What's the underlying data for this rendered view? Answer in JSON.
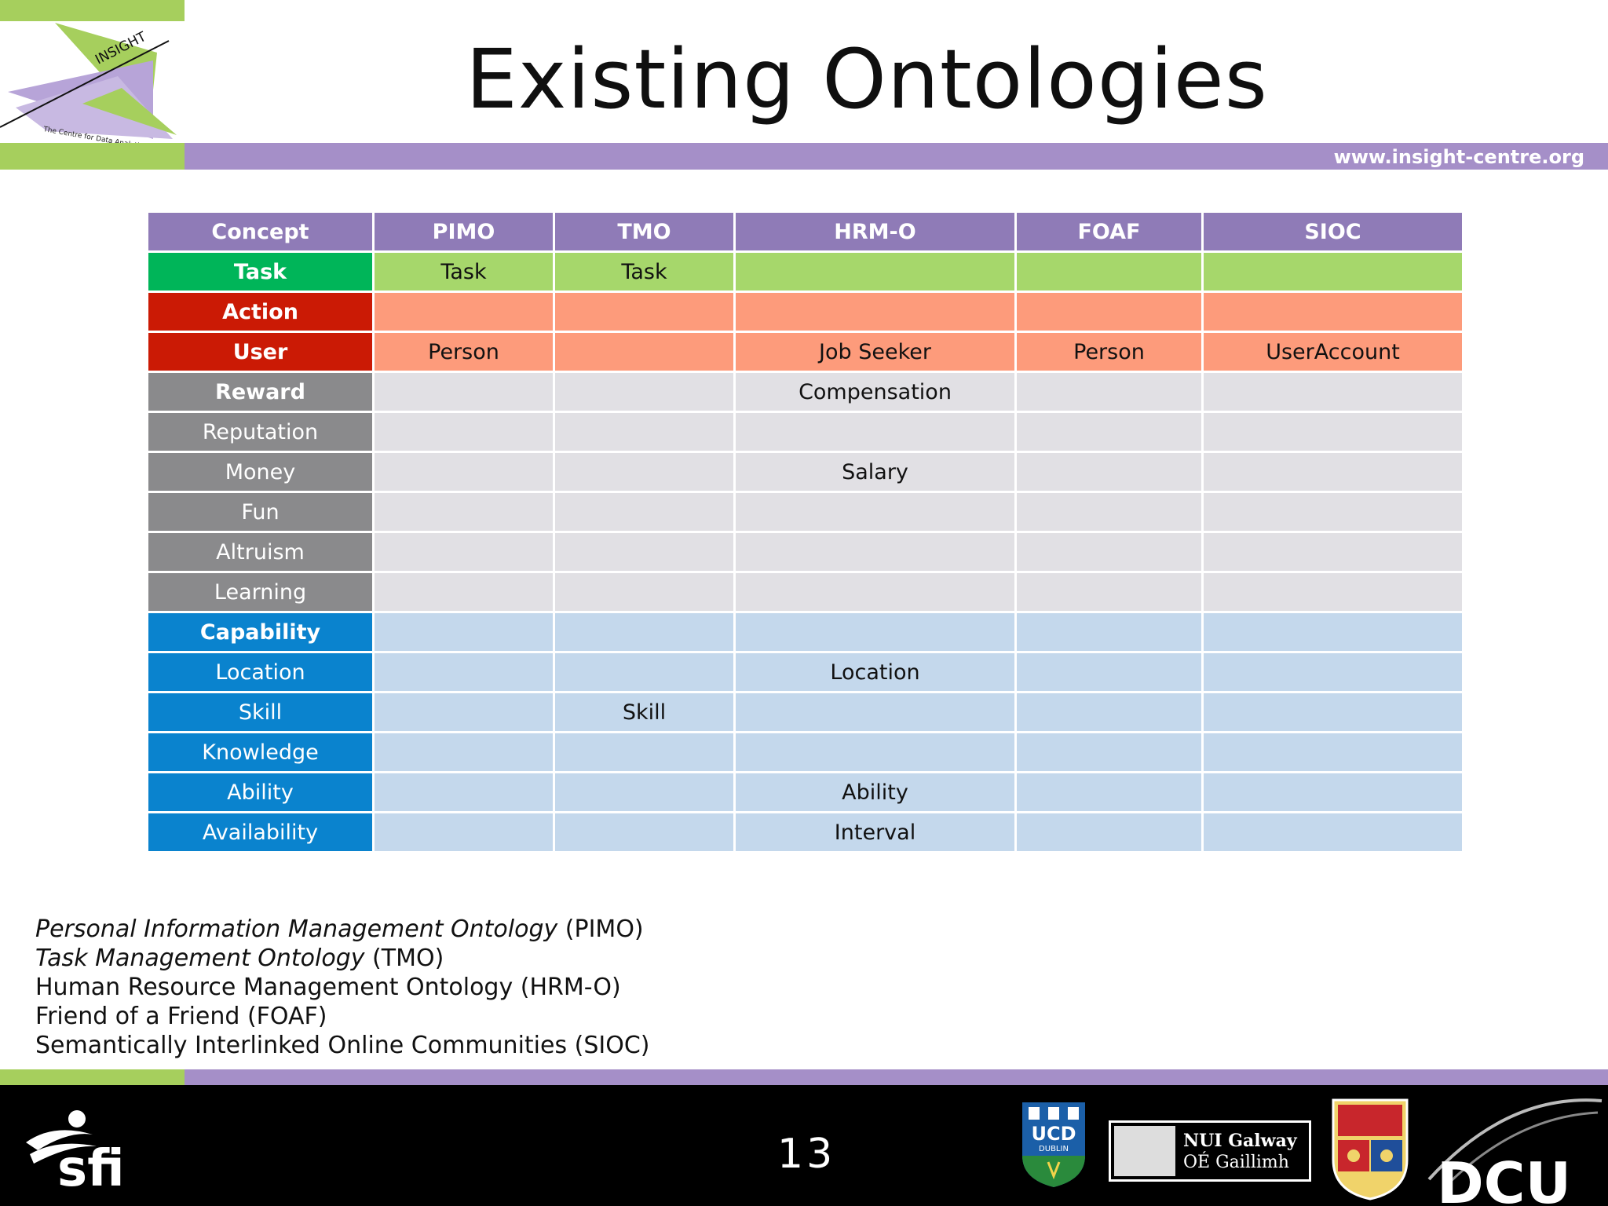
{
  "slide": {
    "title": "Existing Ontologies",
    "url": "www.insight-centre.org",
    "page_number": "13"
  },
  "logo": {
    "name": "INSIGHT",
    "tagline": "The Centre for Data Analytics"
  },
  "table": {
    "headers": [
      "Concept",
      "PIMO",
      "TMO",
      "HRM-O",
      "FOAF",
      "SIOC"
    ],
    "rows": [
      {
        "concept": "Task",
        "cells": [
          "Task",
          "Task",
          "",
          "",
          ""
        ]
      },
      {
        "concept": "Action",
        "cells": [
          "",
          "",
          "",
          "",
          ""
        ]
      },
      {
        "concept": "User",
        "cells": [
          "Person",
          "",
          "Job Seeker",
          "Person",
          "UserAccount"
        ]
      },
      {
        "concept": "Reward",
        "cells": [
          "",
          "",
          "Compensation",
          "",
          ""
        ]
      },
      {
        "concept": "Reputation",
        "cells": [
          "",
          "",
          "",
          "",
          ""
        ]
      },
      {
        "concept": "Money",
        "cells": [
          "",
          "",
          "Salary",
          "",
          ""
        ]
      },
      {
        "concept": "Fun",
        "cells": [
          "",
          "",
          "",
          "",
          ""
        ]
      },
      {
        "concept": "Altruism",
        "cells": [
          "",
          "",
          "",
          "",
          ""
        ]
      },
      {
        "concept": "Learning",
        "cells": [
          "",
          "",
          "",
          "",
          ""
        ]
      },
      {
        "concept": "Capability",
        "cells": [
          "",
          "",
          "",
          "",
          ""
        ]
      },
      {
        "concept": "Location",
        "cells": [
          "",
          "",
          "Location",
          "",
          ""
        ]
      },
      {
        "concept": "Skill",
        "cells": [
          "",
          "Skill",
          "",
          "",
          ""
        ]
      },
      {
        "concept": "Knowledge",
        "cells": [
          "",
          "",
          "",
          "",
          ""
        ]
      },
      {
        "concept": "Ability",
        "cells": [
          "",
          "",
          "Ability",
          "",
          ""
        ]
      },
      {
        "concept": "Availability",
        "cells": [
          "",
          "",
          "Interval",
          "",
          ""
        ]
      }
    ]
  },
  "legend": [
    {
      "name": "Personal Information Management Ontology",
      "abbr": " (PIMO)"
    },
    {
      "name": "Task Management Ontology",
      "abbr": " (TMO)"
    },
    {
      "name": "Human Resource Management Ontology",
      "abbr": " (HRM-O)"
    },
    {
      "name": "Friend of a Friend",
      "abbr": " (FOAF)"
    },
    {
      "name": "Semantically Interlinked Online Communities",
      "abbr": " (SIOC)"
    }
  ],
  "footer_logos": {
    "sfi": "sfi",
    "ucd": "UCD",
    "ucd_sub": "DUBLIN",
    "nuig_line1": "NUI Galway",
    "nuig_line2": "OÉ Gaillimh",
    "dcu": "DCU"
  }
}
